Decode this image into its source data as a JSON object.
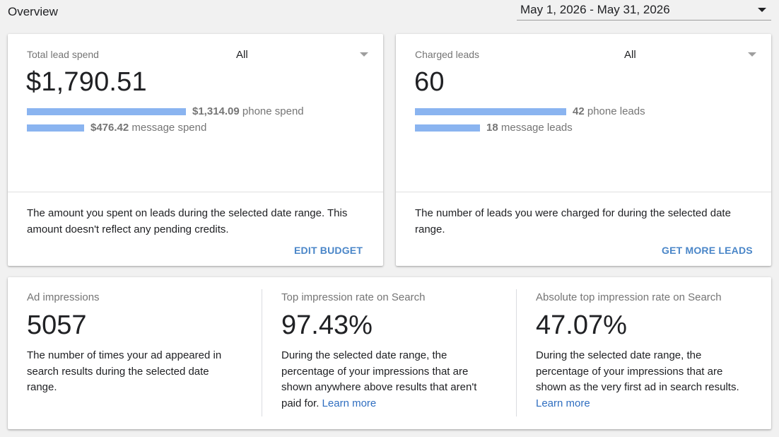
{
  "header": {
    "title": "Overview",
    "date_range": "May 1, 2026 - May 31, 2026"
  },
  "spend_card": {
    "label": "Total lead spend",
    "filter": "All",
    "value": "$1,790.51",
    "bars": [
      {
        "amount": "$1,314.09",
        "text": "phone spend",
        "share": 0.734
      },
      {
        "amount": "$476.42",
        "text": "message spend",
        "share": 0.266
      }
    ],
    "description": "The amount you spent on leads during the selected date range. This amount doesn't reflect any pending credits.",
    "action": "EDIT BUDGET"
  },
  "leads_card": {
    "label": "Charged leads",
    "filter": "All",
    "value": "60",
    "bars": [
      {
        "amount": "42",
        "text": "phone leads",
        "share": 0.7
      },
      {
        "amount": "18",
        "text": "message leads",
        "share": 0.3
      }
    ],
    "description": "The number of leads you were charged for during the selected date range.",
    "action": "GET MORE LEADS"
  },
  "metrics": [
    {
      "label": "Ad impressions",
      "value": "5057",
      "description": "The number of times your ad appeared in search results during the selected date range.",
      "link": ""
    },
    {
      "label": "Top impression rate on Search",
      "value": "97.43%",
      "description": "During the selected date range, the percentage of your impressions that are shown anywhere above results that aren't paid for.",
      "link": "Learn more"
    },
    {
      "label": "Absolute top impression rate on Search",
      "value": "47.07%",
      "description": "During the selected date range, the percentage of your impressions that are shown as the very first ad in search results.",
      "link": "Learn more"
    }
  ],
  "colors": {
    "bar": "#8ab4f0",
    "action": "#4a86c8",
    "link": "#2f6ec0"
  }
}
